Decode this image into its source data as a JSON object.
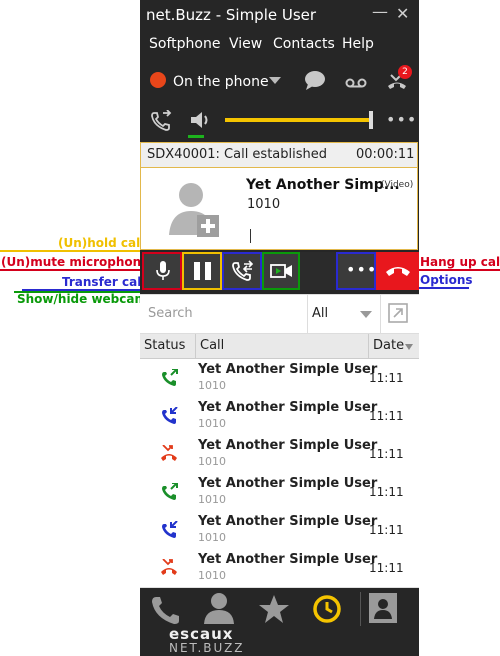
{
  "window": {
    "title": "net.Buzz - Simple User"
  },
  "menu": [
    "Softphone",
    "View",
    "Contacts",
    "Help"
  ],
  "status": {
    "label": "On the phone",
    "missed_badge": "2"
  },
  "call": {
    "header": "SDX40001: Call established",
    "duration": "00:00:11",
    "contact_name": "Yet Another Simp...",
    "video_tag": "(Video)",
    "number": "1010"
  },
  "search": {
    "placeholder": "Search",
    "filter": "All"
  },
  "columns": {
    "status": "Status",
    "call": "Call",
    "date": "Date"
  },
  "history": [
    {
      "name": "Yet Another Simple User",
      "number": "1010",
      "time": "11:11",
      "type": "outgoing",
      "color": "#1a8f2a"
    },
    {
      "name": "Yet Another Simple User",
      "number": "1010",
      "time": "11:11",
      "type": "incoming",
      "color": "#2233cc"
    },
    {
      "name": "Yet Another Simple User",
      "number": "1010",
      "time": "11:11",
      "type": "missed",
      "color": "#e23b1a"
    },
    {
      "name": "Yet Another Simple User",
      "number": "1010",
      "time": "11:11",
      "type": "outgoing",
      "color": "#1a8f2a"
    },
    {
      "name": "Yet Another Simple User",
      "number": "1010",
      "time": "11:11",
      "type": "incoming",
      "color": "#2233cc"
    },
    {
      "name": "Yet Another Simple User",
      "number": "1010",
      "time": "11:11",
      "type": "missed",
      "color": "#e23b1a"
    }
  ],
  "brand": {
    "line1": "escaux",
    "line2": "net.buzz"
  },
  "annotations": {
    "hold": "(Un)hold call",
    "mute": "(Un)mute microphone",
    "transfer": "Transfer call",
    "webcam": "Show/hide webcam",
    "hangup": "Hang up call",
    "options": "Options"
  },
  "colors": {
    "accent_yellow": "#f5c400",
    "hangup_red": "#e8171d",
    "ann_yellow": "#f0c000",
    "ann_red": "#d4001c",
    "ann_blue": "#2a2ad0",
    "ann_green": "#0a9a0a"
  }
}
